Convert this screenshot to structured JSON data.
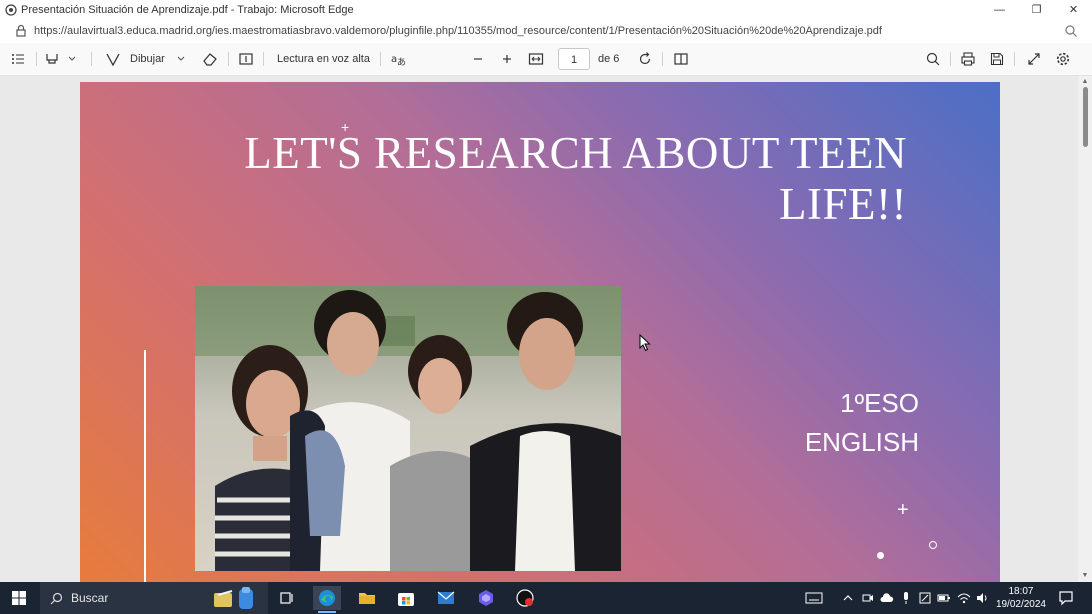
{
  "window": {
    "title": "Presentación Situación de Aprendizaje.pdf - Trabajo: Microsoft Edge",
    "minimize_glyph": "—",
    "restore_glyph": "❐",
    "close_glyph": "✕"
  },
  "address": {
    "url": "https://aulavirtual3.educa.madrid.org/ies.maestromatiasbravo.valdemoro/pluginfile.php/110355/mod_resource/content/1/Presentación%20Situación%20de%20Aprendizaje.pdf"
  },
  "pdf_toolbar": {
    "draw_label": "Dibujar",
    "read_aloud_label": "Lectura en voz alta",
    "page_current": "1",
    "page_total_label": "de 6"
  },
  "slide": {
    "title_line1": "LET'S RESEARCH ABOUT TEEN",
    "title_line2": "LIFE!!",
    "course_line1": "1ºESO",
    "course_line2": "ENGLISH"
  },
  "taskbar": {
    "search_label": "Buscar",
    "time": "18:07",
    "date": "19/02/2024"
  },
  "colors": {
    "slide_gradient_start": "#e87c3a",
    "slide_gradient_end": "#4b6fc6",
    "taskbar_bg": "#1b2433"
  }
}
